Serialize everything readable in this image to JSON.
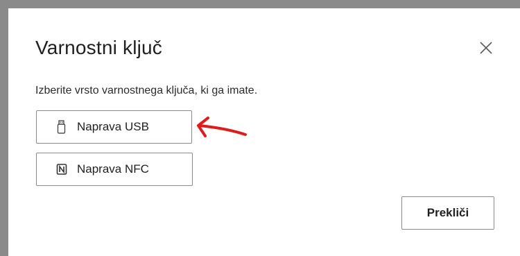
{
  "dialog": {
    "title": "Varnostni ključ",
    "subtitle": "Izberite vrsto varnostnega ključa, ki ga imate.",
    "options": [
      {
        "label": "Naprava USB",
        "icon": "usb-key-icon"
      },
      {
        "label": "Naprava NFC",
        "icon": "nfc-icon"
      }
    ],
    "cancel_label": "Prekliči",
    "close_icon": "close-icon"
  },
  "colors": {
    "backdrop": "#8a8a8a",
    "border": "#8a8a8a",
    "annotation_arrow": "#e01b1b"
  }
}
